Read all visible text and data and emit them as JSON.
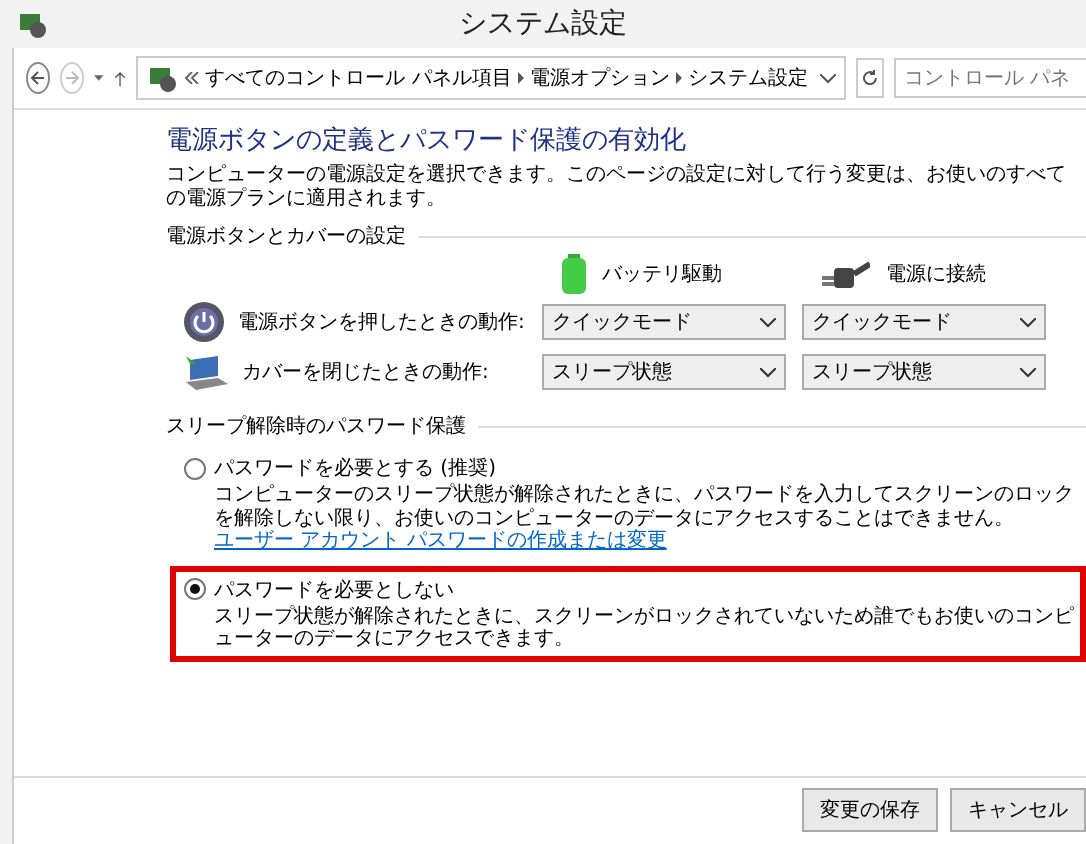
{
  "window": {
    "title": "システム設定"
  },
  "address_bar": {
    "path": [
      {
        "label": "すべてのコントロール パネル項目"
      },
      {
        "label": "電源オプション"
      },
      {
        "label": "システム設定"
      }
    ]
  },
  "search": {
    "placeholder": "コントロール パネ"
  },
  "heading": "電源ボタンの定義とパスワード保護の有効化",
  "description": "コンピューターの電源設定を選択できます。このページの設定に対して行う変更は、お使いのすべての電源プランに適用されます。",
  "power_section": {
    "title": "電源ボタンとカバーの設定",
    "columns": [
      {
        "kind": "battery",
        "label": "バッテリ駆動"
      },
      {
        "kind": "plug",
        "label": "電源に接続"
      }
    ],
    "rows": [
      {
        "kind": "power",
        "label": "電源ボタンを押したときの動作:",
        "values": [
          "クイックモード",
          "クイックモード"
        ]
      },
      {
        "kind": "lid",
        "label": "カバーを閉じたときの動作:",
        "values": [
          "スリープ状態",
          "スリープ状態"
        ]
      }
    ]
  },
  "password_section": {
    "title": "スリープ解除時のパスワード保護",
    "options": [
      {
        "label": "パスワードを必要とする (推奨)",
        "description": "コンピューターのスリープ状態が解除されたときに、パスワードを入力してスクリーンのロックを解除しない限り、お使いのコンピューターのデータにアクセスすることはできません。",
        "link": "ユーザー アカウント パスワードの作成または変更",
        "selected": false,
        "highlighted": false
      },
      {
        "label": "パスワードを必要としない",
        "description": "スリープ状態が解除されたときに、スクリーンがロックされていないため誰でもお使いのコンピューターのデータにアクセスできます。",
        "selected": true,
        "highlighted": true
      }
    ]
  },
  "buttons": [
    {
      "label": "変更の保存"
    },
    {
      "label": "キャンセル"
    }
  ]
}
